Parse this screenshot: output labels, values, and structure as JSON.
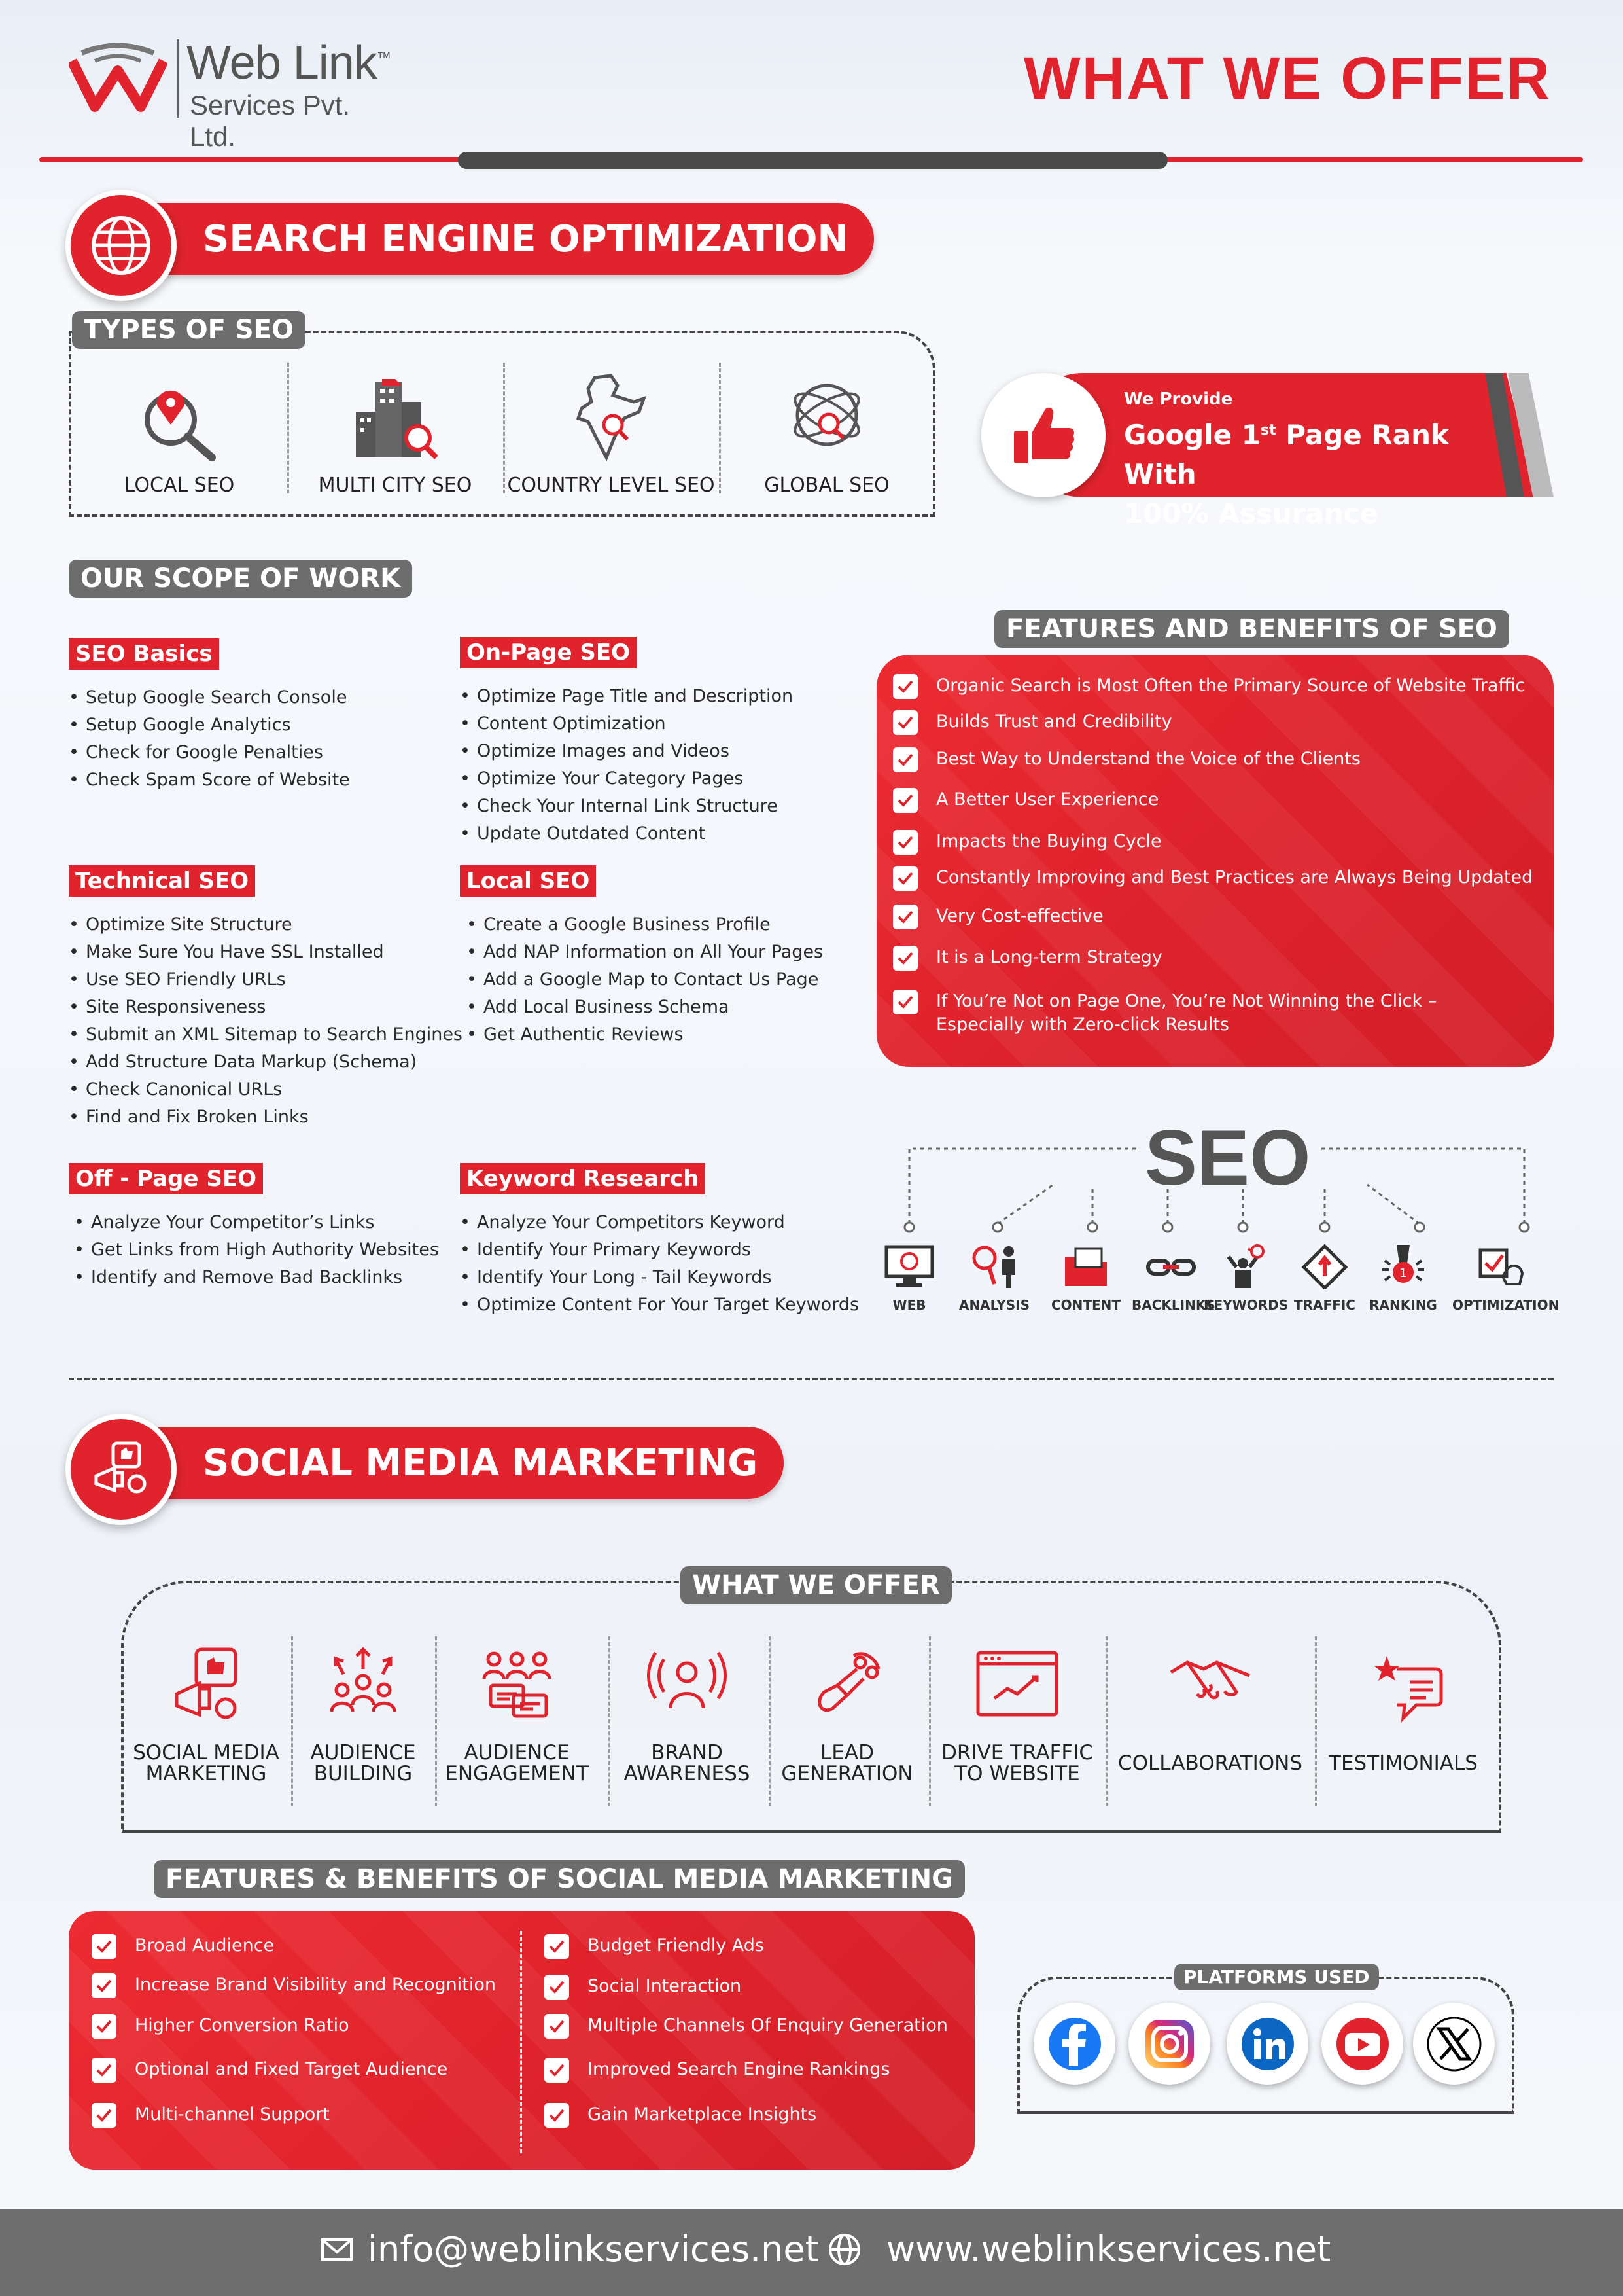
{
  "header": {
    "brand_name": "Web Link",
    "brand_tm": "™",
    "brand_sub": "Services Pvt. Ltd.",
    "title": "WHAT WE OFFER"
  },
  "seo": {
    "banner": "SEARCH ENGINE OPTIMIZATION",
    "types_title": "TYPES OF SEO",
    "types": [
      {
        "label": "LOCAL SEO",
        "icon": "location-search-icon"
      },
      {
        "label": "MULTI CITY SEO",
        "icon": "city-search-icon"
      },
      {
        "label": "COUNTRY LEVEL SEO",
        "icon": "india-map-search-icon"
      },
      {
        "label": "GLOBAL SEO",
        "icon": "globe-search-icon"
      }
    ],
    "guarantee": {
      "small": "We Provide",
      "line1": "Google 1",
      "sup": "st",
      "line1b": " Page Rank With",
      "line2": "100% Assurance"
    },
    "scope_title": "OUR SCOPE OF WORK",
    "scope": {
      "basics": {
        "title": "SEO Basics",
        "items": [
          "Setup Google Search Console",
          "Setup Google Analytics",
          "Check for Google Penalties",
          "Check Spam Score of Website"
        ]
      },
      "onpage": {
        "title": "On-Page SEO",
        "items": [
          "Optimize Page Title and Description",
          "Content Optimization",
          "Optimize Images and Videos",
          "Optimize Your Category Pages",
          "Check Your Internal Link Structure",
          "Update Outdated Content"
        ]
      },
      "technical": {
        "title": "Technical SEO",
        "items": [
          "Optimize Site Structure",
          "Make Sure You Have SSL Installed",
          "Use SEO Friendly URLs",
          "Site Responsiveness",
          "Submit an XML Sitemap to Search Engines",
          "Add Structure Data Markup (Schema)",
          "Check Canonical URLs",
          "Find and Fix Broken Links"
        ]
      },
      "local": {
        "title": "Local SEO",
        "items": [
          "Create a Google Business Profile",
          "Add NAP Information on All Your Pages",
          "Add a Google Map to Contact Us Page",
          "Add Local Business Schema",
          "Get Authentic Reviews"
        ]
      },
      "offpage": {
        "title": "Off - Page SEO",
        "items": [
          "Analyze Your Competitor’s Links",
          "Get Links from High Authority Websites",
          "Identify and Remove Bad Backlinks"
        ]
      },
      "keyword": {
        "title": "Keyword Research",
        "items": [
          "Analyze Your Competitors Keyword",
          "Identify Your Primary Keywords",
          "Identify Your Long - Tail Keywords",
          "Optimize Content For Your Target Keywords"
        ]
      }
    },
    "features_title": "FEATURES AND BENEFITS OF SEO",
    "features": [
      "Organic Search is Most Often the Primary Source of Website Traffic",
      "Builds Trust and Credibility",
      "Best Way to Understand the Voice of the Clients",
      "A Better User Experience",
      "Impacts the Buying Cycle",
      "Constantly Improving and Best Practices are Always Being Updated",
      "Very Cost-effective",
      "It is a Long-term Strategy",
      "If You’re Not on Page One, You’re Not Winning the Click – Especially with Zero-click Results"
    ],
    "diagram_title": "SEO",
    "diagram": [
      "WEB",
      "ANALYSIS",
      "CONTENT",
      "BACKLINKS",
      "KEYWORDS",
      "TRAFFIC",
      "RANKING",
      "OPTIMIZATION"
    ]
  },
  "smm": {
    "banner": "SOCIAL MEDIA MARKETING",
    "offer_title": "WHAT WE OFFER",
    "offers": [
      [
        "SOCIAL MEDIA",
        "MARKETING"
      ],
      [
        "AUDIENCE",
        "BUILDING"
      ],
      [
        "AUDIENCE",
        "ENGAGEMENT"
      ],
      [
        "BRAND",
        "AWARENESS"
      ],
      [
        "LEAD",
        "GENERATION"
      ],
      [
        "DRIVE TRAFFIC",
        "TO WEBSITE"
      ],
      [
        "COLLABORATIONS",
        ""
      ],
      [
        "TESTIMONIALS",
        ""
      ]
    ],
    "features_title": "FEATURES & BENEFITS OF SOCIAL MEDIA MARKETING",
    "features_left": [
      "Broad Audience",
      "Increase Brand Visibility and Recognition",
      "Higher Conversion Ratio",
      "Optional and Fixed Target Audience",
      "Multi-channel Support"
    ],
    "features_right": [
      "Budget Friendly Ads",
      "Social Interaction",
      "Multiple Channels Of Enquiry Generation",
      "Improved Search Engine Rankings",
      "Gain Marketplace Insights"
    ],
    "platforms_title": "PLATFORMS USED",
    "platforms": [
      "facebook-icon",
      "instagram-icon",
      "linkedin-icon",
      "youtube-icon",
      "x-icon"
    ]
  },
  "footer": {
    "email": "info@weblinkservices.net",
    "website": "www.weblinkservices.net"
  },
  "colors": {
    "accent": "#e0232c",
    "grey": "#6d6d6d",
    "dark": "#4a4a4a"
  }
}
